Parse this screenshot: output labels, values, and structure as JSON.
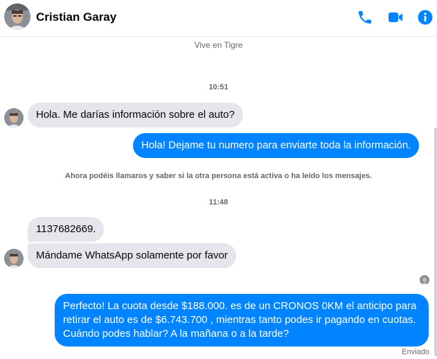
{
  "header": {
    "contact_name": "Cristian Garay",
    "icons": [
      "phone-icon",
      "video-icon",
      "info-icon"
    ],
    "accent_color": "#0084ff"
  },
  "conversation": {
    "subtitle": "Vive en Tigre",
    "time_1": "10:51",
    "time_2": "11:48",
    "notice": "Ahora podéis llamaros y saber si la otra persona está activa o ha leído los mensajes.",
    "messages": [
      {
        "direction": "incoming",
        "text": "Hola. Me darías información sobre el auto?"
      },
      {
        "direction": "outgoing",
        "text": "Hola! Dejame tu numero  para enviarte toda la información."
      },
      {
        "direction": "incoming",
        "text": "1137682669."
      },
      {
        "direction": "incoming",
        "text": "Mándame WhatsApp solamente por favor"
      },
      {
        "direction": "outgoing",
        "text": "Perfecto! La cuota desde $188.000. es de un CRONOS 0KM el anticipo para retirar el auto es de $6.743.700 , mientras tanto podes ir pagando en cuotas. Cuándo podes hablar? A la mañana o a la tarde?"
      }
    ],
    "status": "Enviado"
  }
}
